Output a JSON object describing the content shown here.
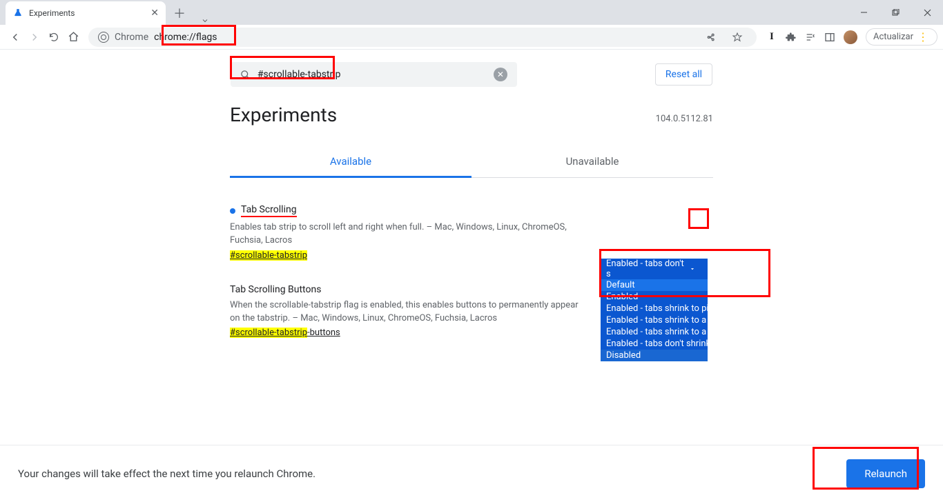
{
  "window": {
    "tab_title": "Experiments",
    "update_label": "Actualizar"
  },
  "omnibox": {
    "prefix": "Chrome",
    "url": "chrome://flags"
  },
  "search": {
    "value": "#scrollable-tabstrip"
  },
  "reset_label": "Reset all",
  "page_title": "Experiments",
  "version": "104.0.5112.81",
  "tabs": {
    "available": "Available",
    "unavailable": "Unavailable"
  },
  "flags": [
    {
      "title": "Tab Scrolling",
      "desc": "Enables tab strip to scroll left and right when full. – Mac, Windows, Linux, ChromeOS, Fuchsia, Lacros",
      "link_hl": "#scrollable-tabstrip",
      "link_rest": ""
    },
    {
      "title": "Tab Scrolling Buttons",
      "desc": "When the scrollable-tabstrip flag is enabled, this enables buttons to permanently appear on the tabstrip. – Mac, Windows, Linux, ChromeOS, Fuchsia, Lacros",
      "link_hl": "#scrollable-tabstrip",
      "link_rest": "-buttons"
    }
  ],
  "select": {
    "current": "Enabled - tabs don't s",
    "options": [
      "Default",
      "Enabled",
      "Enabled - tabs shrink to pinned tab width",
      "Enabled - tabs shrink to a medium width",
      "Enabled - tabs shrink to a large width",
      "Enabled - tabs don't shrink",
      "Disabled"
    ]
  },
  "footer": {
    "msg": "Your changes will take effect the next time you relaunch Chrome.",
    "button": "Relaunch"
  }
}
